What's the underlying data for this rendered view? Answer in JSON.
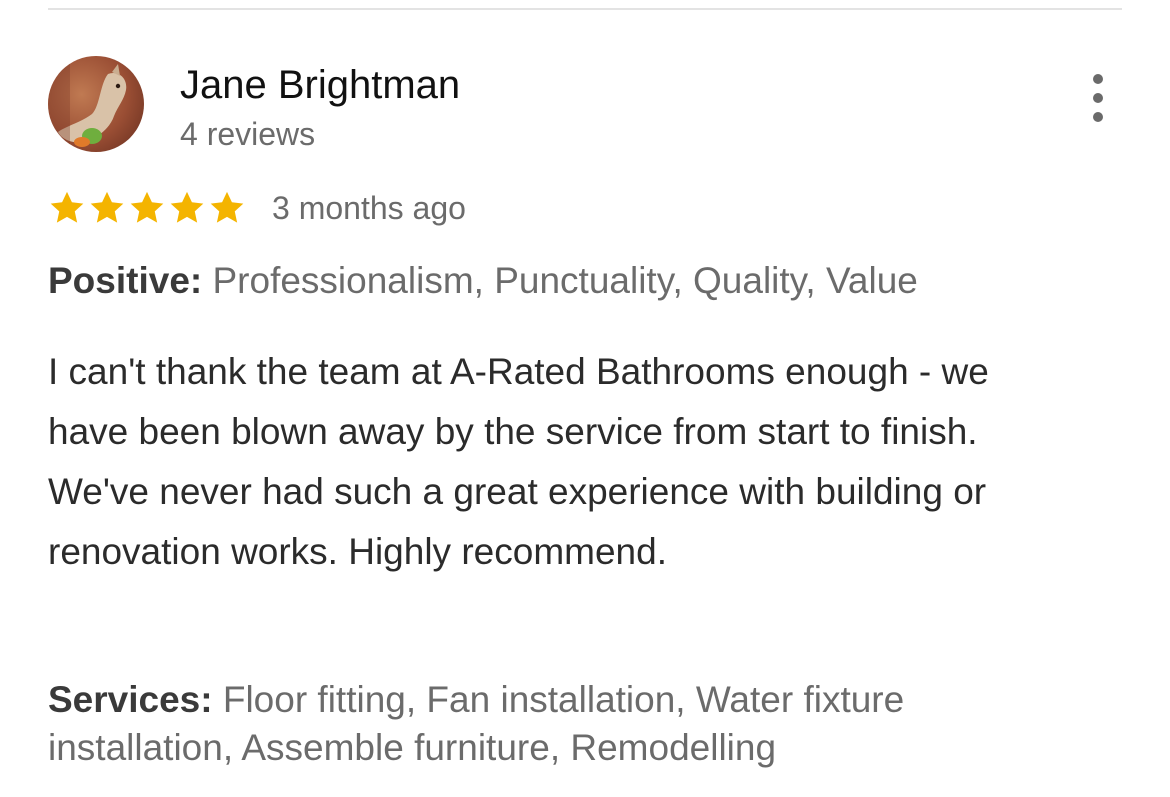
{
  "reviewer": {
    "name": "Jane Brightman",
    "reviews_count": "4 reviews",
    "avatar_icon": "avatar-photo"
  },
  "menu": {
    "icon": "more-vertical-icon"
  },
  "rating": {
    "stars": 5,
    "max_stars": 5,
    "date": "3 months ago",
    "star_color": "#F4B400"
  },
  "positive": {
    "label": "Positive:",
    "value": "Professionalism, Punctuality, Quality, Value"
  },
  "review": {
    "text": "I can't thank the team at A-Rated Bathrooms enough - we have been blown away by the service from start to finish. We've never had such a great experience with building or renovation works. Highly recommend."
  },
  "services": {
    "label": "Services:",
    "value": "Floor fitting, Fan installation, Water fixture installation, Assemble furniture, Remodelling"
  }
}
